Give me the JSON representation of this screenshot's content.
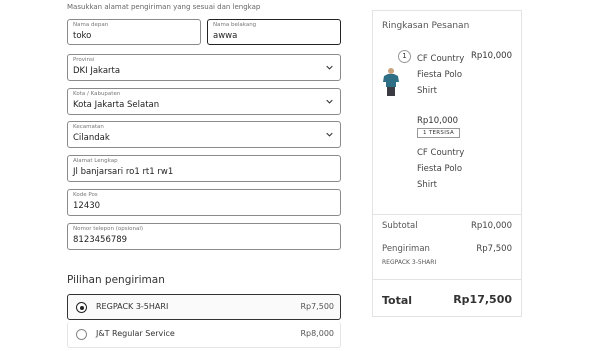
{
  "form": {
    "hint": "Masukkan alamat pengiriman yang sesuai dan lengkap",
    "first_name": {
      "label": "Nama depan",
      "value": "toko"
    },
    "last_name": {
      "label": "Nama belakang",
      "value": "awwa"
    },
    "province": {
      "label": "Provinsi",
      "value": "DKI Jakarta"
    },
    "city": {
      "label": "Kota / Kabupaten",
      "value": "Kota Jakarta Selatan"
    },
    "district": {
      "label": "Kecamatan",
      "value": "Cilandak"
    },
    "address": {
      "label": "Alamat Lengkap",
      "value": "Jl banjarsari ro1 rt1 rw1"
    },
    "postal": {
      "label": "Kode Pos",
      "value": "12430"
    },
    "phone": {
      "label": "Nomor telepon (opsional)",
      "value": "8123456789"
    }
  },
  "shipping": {
    "title": "Pilihan pengiriman",
    "options": [
      {
        "name": "REGPACK 3-5HARI",
        "price": "Rp7,500",
        "selected": true
      },
      {
        "name": "J&T Regular Service",
        "price": "Rp8,000",
        "selected": false
      }
    ]
  },
  "summary": {
    "title": "Ringkasan Pesanan",
    "item": {
      "quantity": "1",
      "name": "CF Country Fiesta Polo Shirt",
      "price": "Rp10,000",
      "unit_price": "Rp10,000",
      "stock_badge": "1 TERSISA",
      "variant": "CF Country Fiesta Polo Shirt",
      "thumb_color": "#2f6f86"
    },
    "subtotal_label": "Subtotal",
    "subtotal_value": "Rp10,000",
    "shipping_label": "Pengiriman",
    "shipping_value": "Rp7,500",
    "shipping_method": "REGPACK 3-5HARI",
    "total_label": "Total",
    "total_value": "Rp17,500"
  }
}
